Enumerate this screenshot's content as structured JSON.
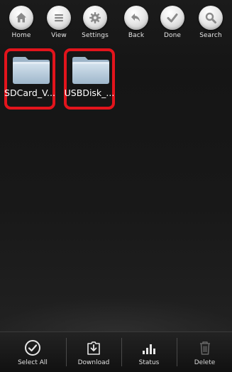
{
  "toolbar": {
    "items": [
      {
        "label": "Home",
        "icon": "home-icon"
      },
      {
        "label": "View",
        "icon": "list-icon"
      },
      {
        "label": "Settings",
        "icon": "gear-icon"
      },
      {
        "label": "Back",
        "icon": "back-arrow-icon"
      },
      {
        "label": "Done",
        "icon": "check-icon"
      },
      {
        "label": "Search",
        "icon": "search-icon"
      }
    ]
  },
  "folders": [
    {
      "name": "SDCard_V...",
      "icon": "folder-icon",
      "highlighted": true
    },
    {
      "name": "USBDisk_...",
      "icon": "folder-icon",
      "highlighted": true
    }
  ],
  "bottom_bar": {
    "items": [
      {
        "label": "Select All",
        "icon": "check-circle-icon",
        "enabled": true
      },
      {
        "label": "Download",
        "icon": "download-icon",
        "enabled": true
      },
      {
        "label": "Status",
        "icon": "bar-chart-icon",
        "enabled": true
      },
      {
        "label": "Delete",
        "icon": "trash-icon",
        "enabled": false
      }
    ]
  },
  "colors": {
    "highlight": "#e3141c",
    "background": "#1b1b1b",
    "folder": "#b9cfe0"
  }
}
